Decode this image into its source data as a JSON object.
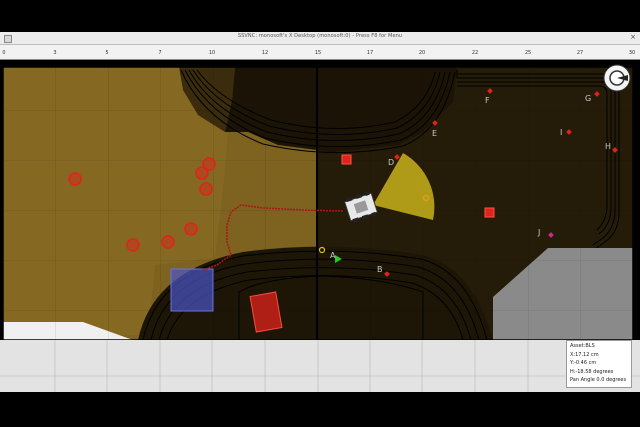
{
  "window": {
    "title": "SSVNC: monosoft's X Desktop (monosoft:0) - Press F8 for Menu",
    "close_glyph": "×"
  },
  "ruler": {
    "labels": [
      "0",
      "3",
      "5",
      "7",
      "10",
      "12",
      "15",
      "17",
      "20",
      "22",
      "25",
      "27",
      "30"
    ]
  },
  "map": {
    "landmarks": [
      {
        "id": "A",
        "label": "A"
      },
      {
        "id": "B",
        "label": "B"
      },
      {
        "id": "D",
        "label": "D"
      },
      {
        "id": "E",
        "label": "E"
      },
      {
        "id": "F",
        "label": "F"
      },
      {
        "id": "G",
        "label": "G"
      },
      {
        "id": "H",
        "label": "H"
      },
      {
        "id": "I",
        "label": "I"
      },
      {
        "id": "J",
        "label": "J"
      }
    ],
    "colors": {
      "lit_field": "#7d6220",
      "dark_field": "#241c08",
      "obstacle_gray": "#8a8a8a",
      "marker_red": "#e0231b",
      "path_red": "#b0141a",
      "sensor_cone": "#c8b21a",
      "zone_blue": "#4c55c8"
    }
  },
  "info": {
    "asset": "Asset:BLS",
    "x": "X:17.12 cm",
    "y": "Y:-0.46 cm",
    "heading": "H:-18.58 degrees",
    "pan": "Pan Angle 0.0 degrees"
  }
}
